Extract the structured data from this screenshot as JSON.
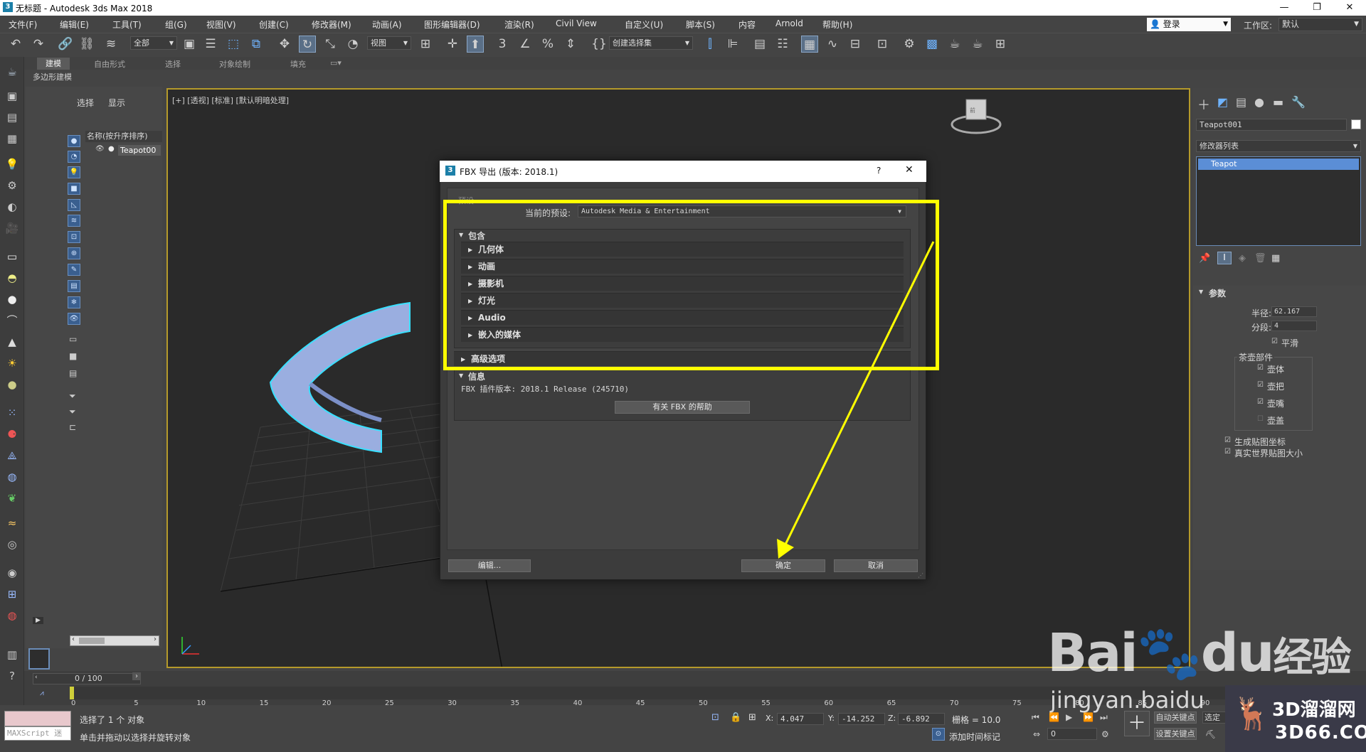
{
  "window": {
    "title": "无标题 - Autodesk 3ds Max 2018",
    "app_icon": "3",
    "minimize": "—",
    "maximize": "❐",
    "close": "✕"
  },
  "menu": [
    "文件(F)",
    "编辑(E)",
    "工具(T)",
    "组(G)",
    "视图(V)",
    "创建(C)",
    "修改器(M)",
    "动画(A)",
    "图形编辑器(D)",
    "渲染(R)",
    "Civil View",
    "自定义(U)",
    "脚本(S)",
    "内容",
    "Arnold",
    "帮助(H)"
  ],
  "login": {
    "label": "登录"
  },
  "workspace": {
    "label": "工作区:",
    "value": "默认"
  },
  "toolbar": {
    "selection_filter": "全部",
    "ref_coord": "视图",
    "named_selection": "创建选择集"
  },
  "ribbon": {
    "tabs": [
      "建模",
      "自由形式",
      "选择",
      "对象绘制",
      "填充"
    ],
    "subtab": "多边形建模"
  },
  "explorer": {
    "tab_select": "选择",
    "tab_display": "显示",
    "header": "名称(按升序排序)",
    "item": "Teapot00"
  },
  "viewport": {
    "label": "[+] [透视] [标准] [默认明暗处理]"
  },
  "dialog": {
    "icon": "3",
    "title": "FBX 导出 (版本: 2018.1)",
    "help_btn": "?",
    "close_btn": "✕",
    "presets_group": "预设",
    "current_preset_label": "当前的预设:",
    "current_preset_value": "Autodesk Media & Entertainment",
    "include": "包含",
    "sections": [
      "几何体",
      "动画",
      "摄影机",
      "灯光",
      "Audio",
      "嵌入的媒体"
    ],
    "advanced": "高级选项",
    "info": "信息",
    "plugin_version": "FBX 插件版本: 2018.1 Release (245710)",
    "help_button": "有关 FBX 的帮助",
    "edit_button": "编辑...",
    "ok_button": "确定",
    "cancel_button": "取消"
  },
  "right_panel": {
    "object_name": "Teapot001",
    "modifier_list": "修改器列表",
    "stack_item": "Teapot",
    "params_title": "参数",
    "radius_label": "半径:",
    "radius_value": "62.167",
    "segments_label": "分段:",
    "segments_value": "4",
    "smooth": "平滑",
    "parts_title": "茶壶部件",
    "parts": [
      "壶体",
      "壶把",
      "壶嘴",
      "壶盖"
    ],
    "parts_checked": [
      true,
      true,
      true,
      false
    ],
    "gen_map": "生成贴图坐标",
    "real_world": "真实世界贴图大小"
  },
  "timeline": {
    "frame": "0 / 100",
    "ticks": [
      "0",
      "5",
      "10",
      "15",
      "20",
      "25",
      "30",
      "35",
      "40",
      "45",
      "50",
      "55",
      "60",
      "65",
      "70",
      "75",
      "80",
      "85",
      "90"
    ]
  },
  "status": {
    "maxscript": "MAXScript 迷",
    "selected": "选择了 1 个 对象",
    "hint": "单击并拖动以选择并旋转对象",
    "x_label": "X:",
    "x_value": "4.047",
    "y_label": "Y:",
    "y_value": "-14.252",
    "z_label": "Z:",
    "z_value": "-6.892",
    "grid": "栅格 = 10.0",
    "auto_key": "自动关键点",
    "set_key": "设置关键点",
    "selected_short": "选定",
    "add_time_tag": "添加时间标记",
    "frame_field": "0"
  },
  "watermark": {
    "brand": "Bai",
    "brand2": "du",
    "jingyan": "经验",
    "url": "jingyan.baidu",
    "site": "3D溜溜网",
    "site_url": "3D66.COM"
  },
  "colors": {
    "highlight": "#ffff00",
    "viewport_border": "#b59a2a",
    "selection_blue": "#5b8ed6"
  }
}
